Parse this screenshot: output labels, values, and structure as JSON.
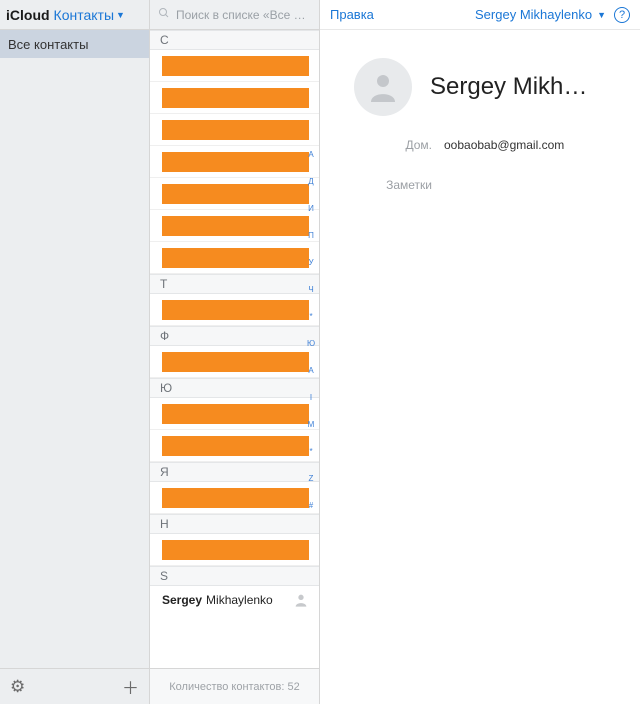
{
  "sidebar": {
    "brand": "iCloud",
    "dropdown_label": "Контакты",
    "group": "Все контакты"
  },
  "search": {
    "placeholder": "Поиск в списке «Все …"
  },
  "list": {
    "sections": [
      {
        "letter": "С",
        "redacted_count": 7
      },
      {
        "letter": "Т",
        "redacted_count": 1
      },
      {
        "letter": "Ф",
        "redacted_count": 1
      },
      {
        "letter": "Ю",
        "redacted_count": 2
      },
      {
        "letter": "Я",
        "redacted_count": 1
      },
      {
        "letter": "H",
        "redacted_count": 1
      },
      {
        "letter": "S",
        "redacted_count": 0
      }
    ],
    "selected": {
      "first": "Sergey",
      "last": "Mikhaylenko"
    },
    "index_letters": [
      "А",
      "Д",
      "И",
      "П",
      "У",
      "Ч",
      "*",
      "Ю",
      "A",
      "I",
      "M",
      "*",
      "Z",
      "#"
    ],
    "footer": "Количество контактов: 52"
  },
  "detail": {
    "edit": "Правка",
    "account": "Sergey Mikhaylenko",
    "name": "Sergey Mikh…",
    "email_label": "Дом.",
    "email_value": "oobaobab@gmail.com",
    "notes_label": "Заметки"
  }
}
